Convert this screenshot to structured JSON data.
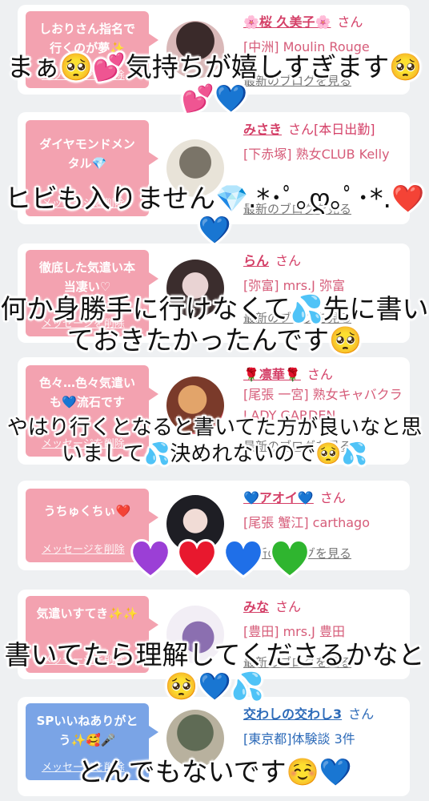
{
  "messages": [
    {
      "bubble_text": "しおりさん指名で行くのが夢✨",
      "delete_label": "メッセージを削除",
      "name": "🌸桜 久美子🌸",
      "san": "さん",
      "shop": "[中洲] Moulin Rouge",
      "blog_link": "最新のブログを見る",
      "bubble_color": "#f3a2b0"
    },
    {
      "bubble_text": "ダイヤモンドメンタル💎",
      "delete_label": "メッセージを削除",
      "name": "みさき",
      "san": "さん[本日出勤]",
      "shop": "[下赤塚] 熟女CLUB Kelly",
      "blog_link": "最新のブログを見る",
      "bubble_color": "#f3a2b0"
    },
    {
      "bubble_text": "徹底した気遣い本当凄い♡",
      "delete_label": "メッセージを削除",
      "name": "らん",
      "san": "さん",
      "shop": "[弥富] mrs.J 弥富",
      "blog_link": "最新のブログを見る",
      "bubble_color": "#f3a2b0"
    },
    {
      "bubble_text": "色々…色々気遣いも💙流石です",
      "delete_label": "メッセージを削除",
      "name": "🌹凛華🌹",
      "san": "さん",
      "shop": "[尾張 一宮] 熟女キャバクラ LADY GARDEN",
      "blog_link": "最新のブログを見る",
      "bubble_color": "#f3a2b0"
    },
    {
      "bubble_text": "うちゅくちぃ❤️",
      "delete_label": "メッセージを削除",
      "name": "💙アオイ💙",
      "san": "さん",
      "shop": "[尾張 蟹江] carthago",
      "blog_link": "最新のブログを見る",
      "bubble_color": "#f3a2b0"
    },
    {
      "bubble_text": "気遣いすてき✨✨",
      "delete_label": "メッセージを削除",
      "name": "みな",
      "san": "さん",
      "shop": "[豊田] mrs.J 豊田",
      "blog_link": "最新のブログを見る",
      "bubble_color": "#f3a2b0"
    },
    {
      "bubble_text": "SPいいねありがとう✨🥰🎤",
      "delete_label": "メッセージを削除",
      "name": "交わしの交わし3",
      "san": "さん",
      "shop": "[東京都]体験談 3件",
      "blog_link": "",
      "bubble_color": "#7aa4e6"
    }
  ],
  "overlay_captions": [
    "まぁ🥺💕気持ちが嬉しすぎます🥺💕💙",
    "ヒビも入りません💎.*･ﾟ｡ღ｡ﾟ･*.❤️💙",
    "何か身勝手に行けなくて💦先に書いておきたかったんです🥺",
    "やはり行くとなると書いてた方が良いなと思いまして💦決めれないので🥺💦",
    "書いてたら理解してくださるかなと🥺💙💦",
    "とんでもないです☺️💙"
  ],
  "hearts": [
    "purple-heart",
    "red-heart",
    "blue-heart",
    "green-heart"
  ],
  "colors": {
    "bubble_pink": "#f3a2b0",
    "bubble_blue": "#7aa4e6",
    "name_pink": "#d43f67",
    "name_blue": "#2c6ab8",
    "heart_purple": "#9b3fd6",
    "heart_red": "#e8182e",
    "heart_blue": "#1f6fe8",
    "heart_green": "#2fb52f"
  }
}
